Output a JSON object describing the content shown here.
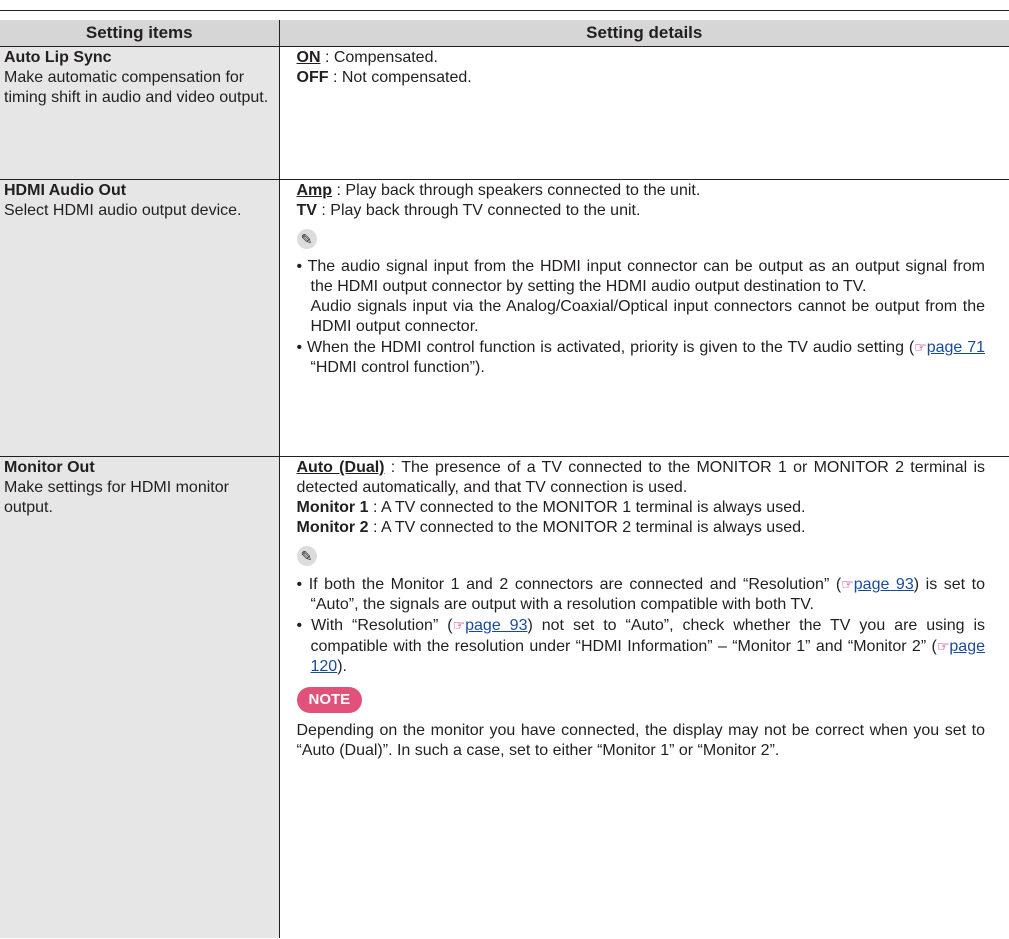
{
  "header": {
    "partial_text": "Setting items                      Setting details",
    "col1": "Setting items",
    "col2": "Setting details"
  },
  "rows": [
    {
      "title": "Auto Lip Sync",
      "desc": "Make automatic compensation for timing shift in audio and video output.",
      "options": [
        {
          "name": "ON",
          "sep": " : ",
          "text": "Compensated."
        },
        {
          "name": "OFF",
          "sep": " : ",
          "text": "Not compensated."
        }
      ]
    },
    {
      "title": "HDMI Audio Out",
      "desc": "Select HDMI audio output device.",
      "options": [
        {
          "name": "Amp",
          "sep": " : ",
          "text": "Play back through speakers connected to the unit."
        },
        {
          "name": "TV",
          "sep": " : ",
          "text": "Play back through TV connected to the unit."
        }
      ],
      "memo_icon": "pencil-icon",
      "bullets": [
        "The audio signal input from the HDMI input connector can be output as an output signal from the HDMI output connector by setting the HDMI audio output destination to TV.",
        "Audio signals input via the Analog/Coaxial/Optical input connectors cannot be output from the HDMI output connector.",
        "When the HDMI control function is activated, priority is given to the TV audio setting (",
        "page 71",
        " “HDMI control function”)."
      ]
    },
    {
      "title": "Monitor Out",
      "desc": "Make settings for HDMI monitor output.",
      "options": [
        {
          "name": "Auto (Dual)",
          "sep": " : ",
          "text": "The presence of a TV connected to the MONITOR 1 or MONITOR 2 terminal is detected automatically, and that TV connection is used."
        },
        {
          "name": "Monitor 1",
          "sep": " : ",
          "text": "A TV connected to the MONITOR 1 terminal is always used."
        },
        {
          "name": "Monitor 2",
          "sep": " : ",
          "text": "A TV connected to the MONITOR 2 terminal is always used."
        }
      ],
      "memo_icon": "pencil-icon",
      "b1a": "If both the Monitor 1 and 2 connectors are connected and “Resolution” (",
      "b1ref": "page 93",
      "b1b": ") is set to “Auto”, the signals are output with a resolution compatible with both TV.",
      "b2a": "With “Resolution” (",
      "b2ref": "page 93",
      "b2b": ") not set to “Auto”, check whether the TV you are using is compatible with the resolution under “HDMI Information” – “Monitor 1” and “Monitor 2” (",
      "b2ref2": "page 120",
      "b2c": ").",
      "note_label": "NOTE",
      "note_text": "Depending on the monitor you have connected, the display may not be correct when you set to “Auto (Dual)”. In such a case, set to either “Monitor 1” or “Monitor 2”."
    }
  ],
  "ref_icon": "reference-hand-icon"
}
